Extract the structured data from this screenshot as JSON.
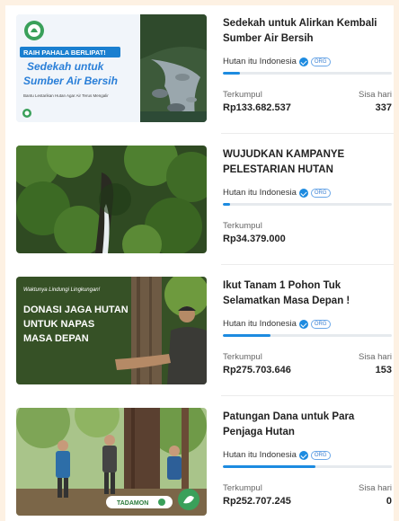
{
  "campaigns": [
    {
      "title": "Sedekah untuk Alirkan Kembali Sumber Air Bersih",
      "organizer": "Hutan itu Indonesia",
      "org_badge": "ORG",
      "progress": 0.1,
      "collected_label": "Terkumpul",
      "collected_value": "Rp133.682.537",
      "days_label": "Sisa hari",
      "days_value": "337",
      "image": {
        "banner": "RAIH PAHALA BERLIPAT!",
        "headline_1": "Sedekah untuk",
        "headline_2": "Sumber Air Bersih",
        "caption": "Bantu Lestarikan Hutan Agar Air Terus Mengalir"
      }
    },
    {
      "title": "WUJUDKAN KAMPANYE PELESTARIAN HUTAN INDONESIA",
      "organizer": "Hutan itu Indonesia",
      "org_badge": "ORG",
      "progress": 0.04,
      "collected_label": "Terkumpul",
      "collected_value": "Rp34.379.000",
      "days_label": "",
      "days_value": ""
    },
    {
      "title": "Ikut Tanam 1 Pohon Tuk Selamatkan Masa Depan !",
      "organizer": "Hutan itu Indonesia",
      "org_badge": "ORG",
      "progress": 0.28,
      "collected_label": "Terkumpul",
      "collected_value": "Rp275.703.646",
      "days_label": "Sisa hari",
      "days_value": "153",
      "image": {
        "tagline": "Waktunya Lindungi Lingkungan!",
        "headline_1": "DONASI JAGA HUTAN",
        "headline_2": "UNTUK NAPAS",
        "headline_3": "MASA DEPAN"
      }
    },
    {
      "title": "Patungan Dana untuk Para Penjaga Hutan",
      "organizer": "Hutan itu Indonesia",
      "org_badge": "ORG",
      "progress": 0.55,
      "collected_label": "Terkumpul",
      "collected_value": "Rp252.707.245",
      "days_label": "Sisa hari",
      "days_value": "0",
      "image": {
        "badge": "TADAMON"
      }
    }
  ],
  "colors": {
    "page_background": "#fdf1e3",
    "accent": "#1d8be0",
    "progress_track": "#e6eaee"
  }
}
